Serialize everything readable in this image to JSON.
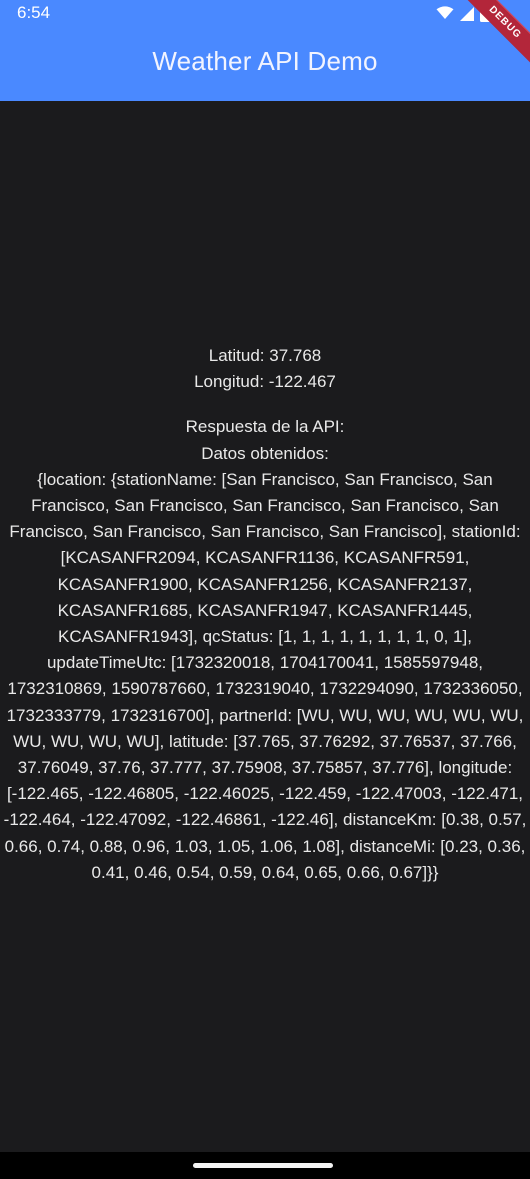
{
  "status_bar": {
    "time": "6:54",
    "icons": [
      "wifi-icon",
      "signal-icon",
      "battery-icon"
    ]
  },
  "app_bar": {
    "title": "Weather API Demo",
    "background_color": "#4a89ff",
    "debug_banner": "DEBUG"
  },
  "main": {
    "latitude_line": "Latitud: 37.768",
    "longitude_line": "Longitud: -122.467",
    "response_heading": "Respuesta de la API:",
    "data_heading": "Datos obtenidos:",
    "response_body": "{location: {stationName: [San Francisco, San Francisco, San Francisco, San Francisco, San Francisco, San Francisco, San Francisco, San Francisco, San Francisco, San Francisco], stationId: [KCASANFR2094, KCASANFR1136, KCASANFR591, KCASANFR1900, KCASANFR1256, KCASANFR2137, KCASANFR1685, KCASANFR1947, KCASANFR1445, KCASANFR1943], qcStatus: [1, 1, 1, 1, 1, 1, 1, 1, 0, 1], updateTimeUtc: [1732320018, 1704170041, 1585597948, 1732310869, 1590787660, 1732319040, 1732294090, 1732336050, 1732333779, 1732316700], partnerId: [WU, WU, WU, WU, WU, WU, WU, WU, WU, WU], latitude: [37.765, 37.76292, 37.76537, 37.766, 37.76049, 37.76, 37.777, 37.75908, 37.75857, 37.776], longitude: [-122.465, -122.46805, -122.46025, -122.459, -122.47003, -122.471, -122.464, -122.47092, -122.46861, -122.46], distanceKm: [0.38, 0.57, 0.66, 0.74, 0.88, 0.96, 1.03, 1.05, 1.06, 1.08], distanceMi: [0.23, 0.36, 0.41, 0.46, 0.54, 0.59, 0.64, 0.65, 0.66, 0.67]}}"
  },
  "colors": {
    "background": "#1b1b1d",
    "text": "#e9e9e9",
    "debug_ribbon": "#b3263a"
  }
}
